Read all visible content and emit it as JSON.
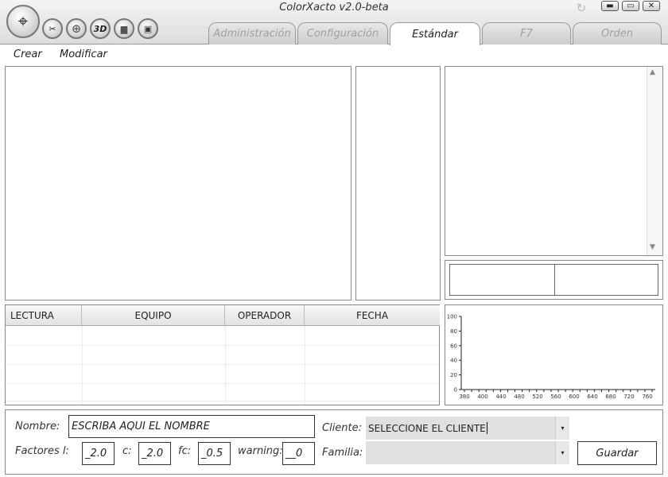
{
  "app": {
    "title": "ColorXacto  v2.0-beta"
  },
  "toolbar": {
    "tools": [
      {
        "name": "tools-icon",
        "glyph": "✂"
      },
      {
        "name": "target-icon",
        "glyph": "⊕"
      },
      {
        "name": "3d-icon",
        "glyph": "3D"
      },
      {
        "name": "folder-icon",
        "glyph": "▆"
      },
      {
        "name": "save-icon",
        "glyph": "▣"
      }
    ],
    "logo_glyph": "⌖"
  },
  "window": {
    "minimize": "▬",
    "maximize": "▭",
    "close": "✕",
    "refresh": "↻"
  },
  "tabs": [
    {
      "label": "Administración",
      "active": false
    },
    {
      "label": "Configuración",
      "active": false
    },
    {
      "label": "Estándar",
      "active": true
    },
    {
      "label": "F7",
      "active": false
    },
    {
      "label": "Orden",
      "active": false
    }
  ],
  "menu": {
    "create": "Crear",
    "modify": "Modificar"
  },
  "table": {
    "columns": [
      "LECTURA",
      "EQUIPO",
      "OPERADOR",
      "FECHA"
    ]
  },
  "chart_data": {
    "type": "line",
    "x_ticks": [
      "380",
      "400",
      "440",
      "480",
      "520",
      "560",
      "600",
      "640",
      "680",
      "720",
      "760"
    ],
    "y_ticks": [
      "100",
      "80",
      "60",
      "40",
      "20",
      "0"
    ],
    "ylim": [
      0,
      100
    ],
    "series": []
  },
  "form": {
    "name_label": "Nombre:",
    "name_value": "ESCRIBA AQUI EL NOMBRE",
    "client_label": "Cliente:",
    "client_value": "SELECCIONE EL CLIENTE",
    "family_label": "Familia:",
    "family_value": "",
    "factors_label": "Factores  l:",
    "l_value": "_2.0",
    "c_label": "c:",
    "c_value": "_2.0",
    "fc_label": "fc:",
    "fc_value": "_0.5",
    "warning_label": "warning:",
    "warning_value": "__0",
    "save_label": "Guardar",
    "dropdown_glyph": "▾"
  },
  "scrollbar": {
    "up": "▲",
    "down": "▼"
  }
}
